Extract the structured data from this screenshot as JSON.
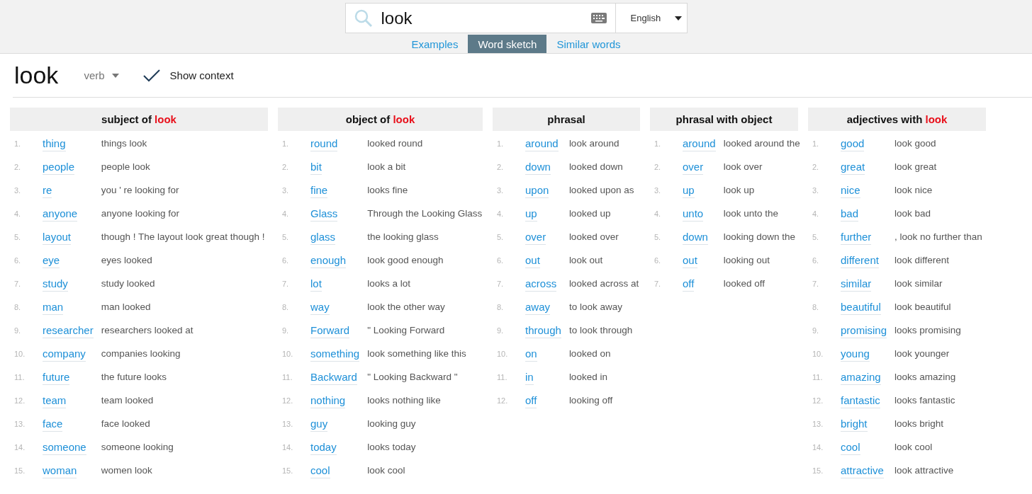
{
  "search": {
    "value": "look",
    "language": "English"
  },
  "tabs": [
    {
      "label": "Examples",
      "selected": false
    },
    {
      "label": "Word sketch",
      "selected": true
    },
    {
      "label": "Similar words",
      "selected": false
    }
  ],
  "headword": "look",
  "pos": "verb",
  "show_context": {
    "label": "Show context",
    "checked": true
  },
  "columns": [
    {
      "title": "subject of",
      "keyword": "look",
      "rows": [
        {
          "number": "1.",
          "word": "thing",
          "context": "things look"
        },
        {
          "number": "2.",
          "word": "people",
          "context": "people look"
        },
        {
          "number": "3.",
          "word": "re",
          "context": "you ' re looking for"
        },
        {
          "number": "4.",
          "word": "anyone",
          "context": "anyone looking for"
        },
        {
          "number": "5.",
          "word": "layout",
          "context": "though ! The layout look great though !"
        },
        {
          "number": "6.",
          "word": "eye",
          "context": "eyes looked"
        },
        {
          "number": "7.",
          "word": "study",
          "context": "study looked"
        },
        {
          "number": "8.",
          "word": "man",
          "context": "man looked"
        },
        {
          "number": "9.",
          "word": "researcher",
          "context": "researchers looked at"
        },
        {
          "number": "10.",
          "word": "company",
          "context": "companies looking"
        },
        {
          "number": "11.",
          "word": "future",
          "context": "the future looks"
        },
        {
          "number": "12.",
          "word": "team",
          "context": "team looked"
        },
        {
          "number": "13.",
          "word": "face",
          "context": "face looked"
        },
        {
          "number": "14.",
          "word": "someone",
          "context": "someone looking"
        },
        {
          "number": "15.",
          "word": "woman",
          "context": "women look"
        }
      ]
    },
    {
      "title": "object of",
      "keyword": "look",
      "rows": [
        {
          "number": "1.",
          "word": "round",
          "context": "looked round"
        },
        {
          "number": "2.",
          "word": "bit",
          "context": "look a bit"
        },
        {
          "number": "3.",
          "word": "fine",
          "context": "looks fine"
        },
        {
          "number": "4.",
          "word": "Glass",
          "context": "Through the Looking Glass"
        },
        {
          "number": "5.",
          "word": "glass",
          "context": "the looking glass"
        },
        {
          "number": "6.",
          "word": "enough",
          "context": "look good enough"
        },
        {
          "number": "7.",
          "word": "lot",
          "context": "looks a lot"
        },
        {
          "number": "8.",
          "word": "way",
          "context": "look the other way"
        },
        {
          "number": "9.",
          "word": "Forward",
          "context": "\" Looking Forward"
        },
        {
          "number": "10.",
          "word": "something",
          "context": "look something like this"
        },
        {
          "number": "11.",
          "word": "Backward",
          "context": "\" Looking Backward \""
        },
        {
          "number": "12.",
          "word": "nothing",
          "context": "looks nothing like"
        },
        {
          "number": "13.",
          "word": "guy",
          "context": "looking guy"
        },
        {
          "number": "14.",
          "word": "today",
          "context": "looks today"
        },
        {
          "number": "15.",
          "word": "cool",
          "context": "look cool"
        }
      ]
    },
    {
      "title": "phrasal",
      "rows": [
        {
          "number": "1.",
          "word": "around",
          "context": "look around"
        },
        {
          "number": "2.",
          "word": "down",
          "context": "looked down"
        },
        {
          "number": "3.",
          "word": "upon",
          "context": "looked upon as"
        },
        {
          "number": "4.",
          "word": "up",
          "context": "looked up"
        },
        {
          "number": "5.",
          "word": "over",
          "context": "looked over"
        },
        {
          "number": "6.",
          "word": "out",
          "context": "look out"
        },
        {
          "number": "7.",
          "word": "across",
          "context": "looked across at"
        },
        {
          "number": "8.",
          "word": "away",
          "context": "to look away"
        },
        {
          "number": "9.",
          "word": "through",
          "context": "to look through"
        },
        {
          "number": "10.",
          "word": "on",
          "context": "looked on"
        },
        {
          "number": "11.",
          "word": "in",
          "context": "looked in"
        },
        {
          "number": "12.",
          "word": "off",
          "context": "looking off"
        }
      ]
    },
    {
      "title": "phrasal with object",
      "rows": [
        {
          "number": "1.",
          "word": "around",
          "context": "looked around the"
        },
        {
          "number": "2.",
          "word": "over",
          "context": "look over"
        },
        {
          "number": "3.",
          "word": "up",
          "context": "look up"
        },
        {
          "number": "4.",
          "word": "unto",
          "context": "look unto the"
        },
        {
          "number": "5.",
          "word": "down",
          "context": "looking down the"
        },
        {
          "number": "6.",
          "word": "out",
          "context": "looking out"
        },
        {
          "number": "7.",
          "word": "off",
          "context": "looked off"
        }
      ]
    },
    {
      "title": "adjectives with",
      "keyword": "look",
      "rows": [
        {
          "number": "1.",
          "word": "good",
          "context": "look good"
        },
        {
          "number": "2.",
          "word": "great",
          "context": "look great"
        },
        {
          "number": "3.",
          "word": "nice",
          "context": "look nice"
        },
        {
          "number": "4.",
          "word": "bad",
          "context": "look bad"
        },
        {
          "number": "5.",
          "word": "further",
          "context": ", look no further than"
        },
        {
          "number": "6.",
          "word": "different",
          "context": "look different"
        },
        {
          "number": "7.",
          "word": "similar",
          "context": "look similar"
        },
        {
          "number": "8.",
          "word": "beautiful",
          "context": "look beautiful"
        },
        {
          "number": "9.",
          "word": "promising",
          "context": "looks promising"
        },
        {
          "number": "10.",
          "word": "young",
          "context": "look younger"
        },
        {
          "number": "11.",
          "word": "amazing",
          "context": "looks amazing"
        },
        {
          "number": "12.",
          "word": "fantastic",
          "context": "looks fantastic"
        },
        {
          "number": "13.",
          "word": "bright",
          "context": "looks bright"
        },
        {
          "number": "14.",
          "word": "cool",
          "context": "look cool"
        },
        {
          "number": "15.",
          "word": "attractive",
          "context": "look attractive"
        }
      ]
    }
  ]
}
